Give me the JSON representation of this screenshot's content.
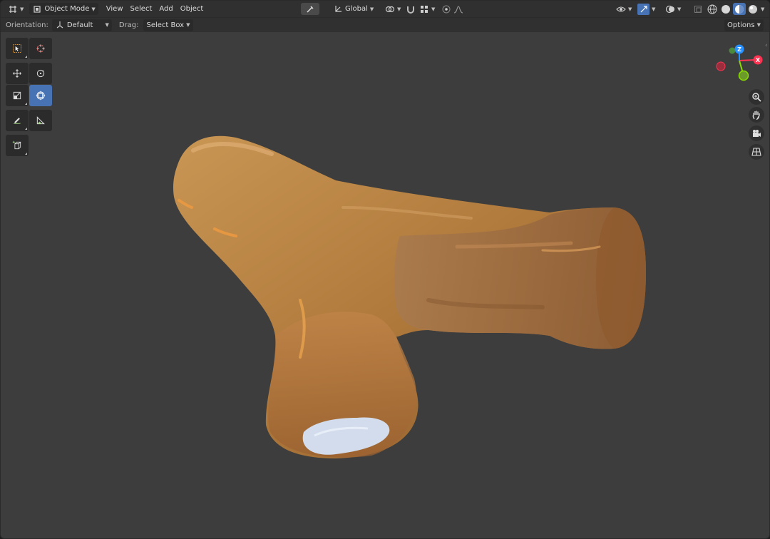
{
  "header": {
    "editor_type_icon": "editor-type-icon",
    "mode": {
      "label": "Object Mode",
      "icon": "object-mode-icon"
    },
    "menus": [
      "View",
      "Select",
      "Add",
      "Object"
    ],
    "transform_orientation": {
      "label": "Global",
      "icon": "transform-orientation-icon"
    },
    "shading_modes": [
      "wireframe",
      "solid",
      "material-preview",
      "rendered"
    ],
    "active_shading": "material-preview"
  },
  "tool_settings": {
    "orientation_label": "Orientation:",
    "orientation_value": "Default",
    "drag_label": "Drag:",
    "drag_value": "Select Box",
    "options_label": "Options"
  },
  "toolbar": {
    "tools": [
      {
        "name": "select-box-tool",
        "icon": "select-box-icon"
      },
      {
        "name": "cursor-tool",
        "icon": "cursor-icon"
      },
      {
        "name": "move-tool",
        "icon": "move-icon"
      },
      {
        "name": "rotate-tool",
        "icon": "rotate-icon"
      },
      {
        "name": "scale-tool",
        "icon": "scale-icon"
      },
      {
        "name": "transform-tool",
        "icon": "transform-icon",
        "active": true
      },
      {
        "name": "annotate-tool",
        "icon": "annotate-icon"
      },
      {
        "name": "measure-tool",
        "icon": "measure-icon"
      },
      {
        "name": "add-cube-tool",
        "icon": "add-cube-icon"
      }
    ]
  },
  "gizmo": {
    "axes": [
      "Z",
      "X",
      "Y"
    ],
    "colors": {
      "x": "#ff3352",
      "y": "#8bdc00",
      "z": "#2890ff"
    }
  },
  "nav_buttons": [
    "zoom-icon",
    "pan-hand-icon",
    "camera-icon",
    "grid-view-icon"
  ],
  "colors": {
    "viewport_bg": "#3d3d3d",
    "header_bg": "#303030",
    "accent": "#4772b3",
    "object_base": "#b07a3c"
  }
}
